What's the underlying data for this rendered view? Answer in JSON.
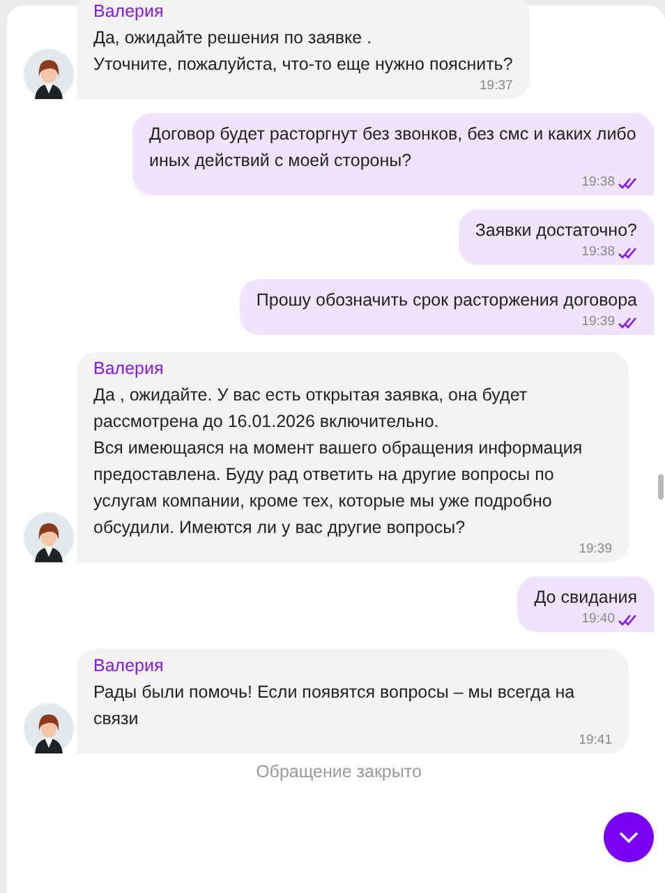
{
  "messages": [
    {
      "kind": "agent",
      "name": "Валерия",
      "paragraphs": [
        "Да, ожидайте решения по заявке .",
        "Уточните, пожалуйста, что-то еще нужно пояснить?"
      ],
      "time": "19:37"
    },
    {
      "kind": "user",
      "paragraphs": [
        "Договор будет расторгнут без звонков, без смс и каких либо иных действий с моей стороны?"
      ],
      "time": "19:38",
      "read": true
    },
    {
      "kind": "user",
      "paragraphs": [
        "Заявки достаточно?"
      ],
      "time": "19:38",
      "read": true
    },
    {
      "kind": "user",
      "paragraphs": [
        "Прошу обозначить срок расторжения договора"
      ],
      "time": "19:39",
      "read": true
    },
    {
      "kind": "agent",
      "name": "Валерия",
      "paragraphs": [
        "Да , ожидайте. У вас есть открытая заявка, она будет рассмотрена до 16.01.2026 включительно.",
        "Вся имеющаяся на момент вашего обращения информация предоставлена. Буду рад ответить на другие вопросы по услугам компании, кроме тех, которые мы уже подробно обсудили. Имеются ли у вас другие вопросы?"
      ],
      "time": "19:39"
    },
    {
      "kind": "user",
      "paragraphs": [
        "До свидания"
      ],
      "time": "19:40",
      "read": true
    },
    {
      "kind": "agent",
      "name": "Валерия",
      "paragraphs": [
        "Рады были помочь! Если появятся вопросы – мы всегда на связи"
      ],
      "time": "19:41"
    }
  ],
  "status": "Обращение закрыто"
}
